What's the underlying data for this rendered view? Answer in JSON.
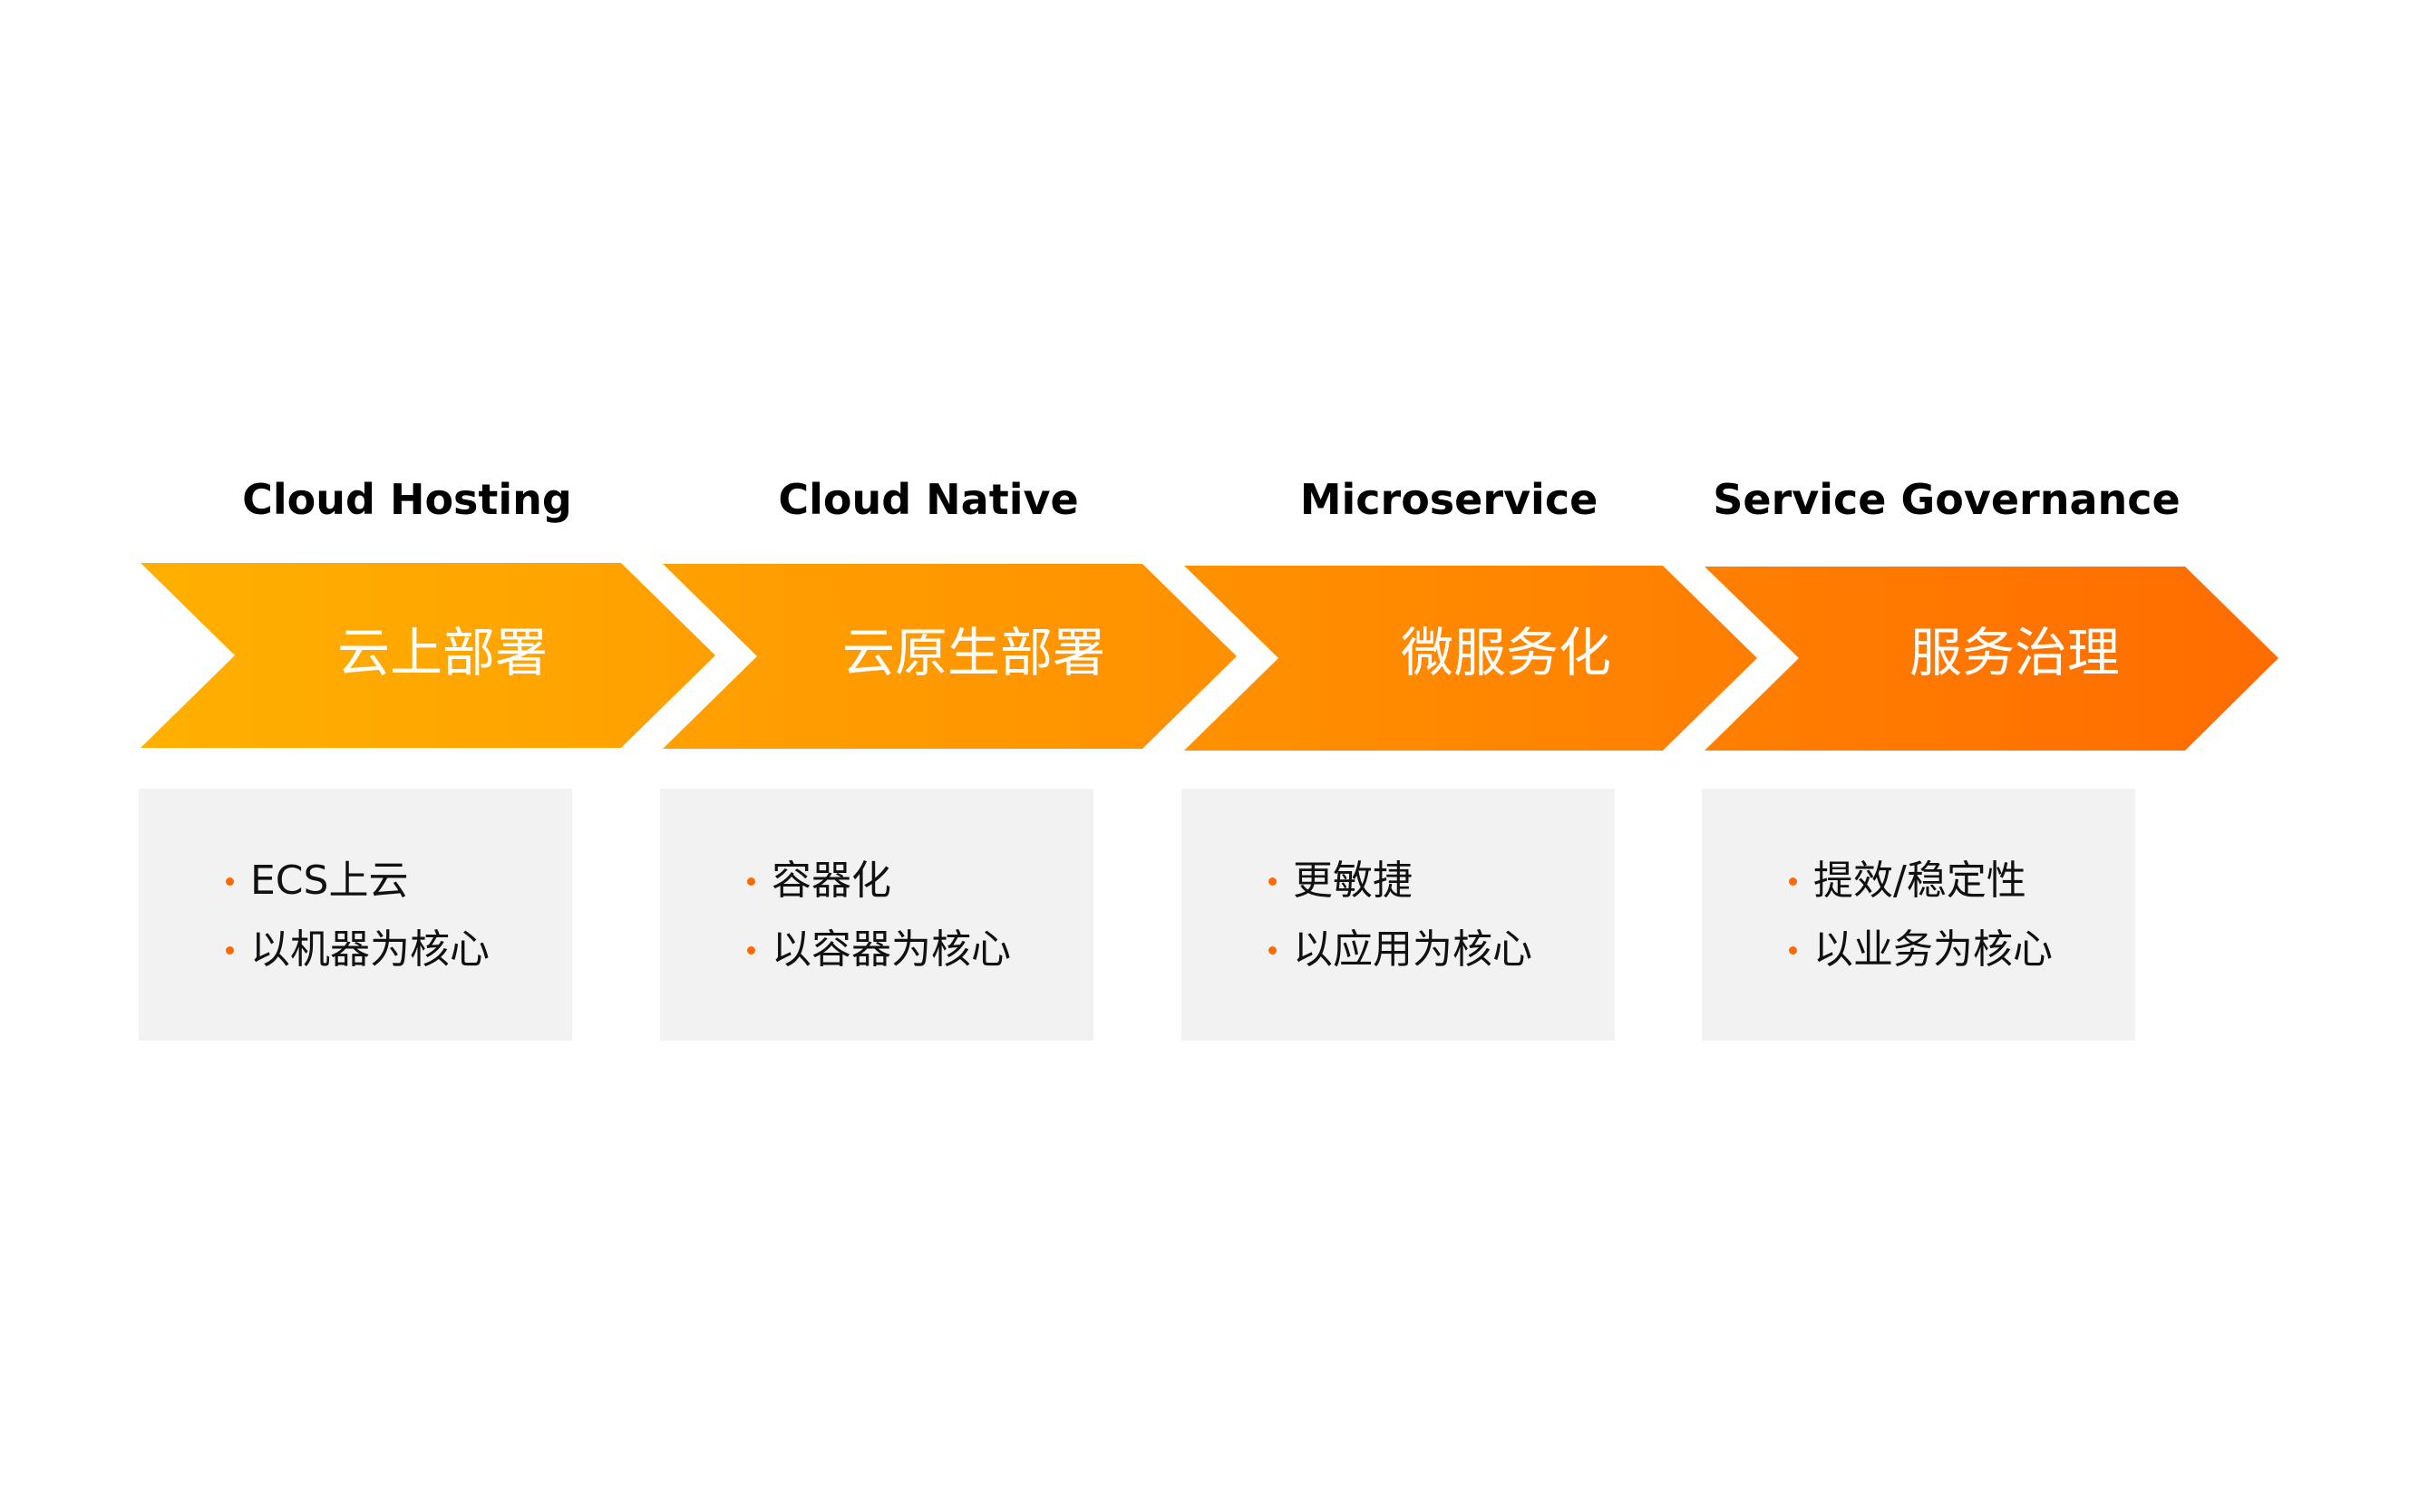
{
  "colors": {
    "gradient_start": "#FFB000",
    "gradient_mid": "#FF9400",
    "gradient_end": "#FF6C00",
    "bullet": "#FF6A00",
    "box_bg": "#F2F2F2",
    "label_text": "#FFFFFF",
    "heading_text": "#000000"
  },
  "stages": [
    {
      "heading": "Cloud Hosting",
      "label": "云上部署",
      "bullets": [
        "ECS上云",
        "以机器为核心"
      ]
    },
    {
      "heading": "Cloud Native",
      "label": "云原生部署",
      "bullets": [
        "容器化",
        "以容器为核心"
      ]
    },
    {
      "heading": "Microservice",
      "label": "微服务化",
      "bullets": [
        "更敏捷",
        "以应用为核心"
      ]
    },
    {
      "heading": "Service Governance",
      "label": "服务治理",
      "bullets": [
        "提效/稳定性",
        "以业务为核心"
      ]
    }
  ]
}
